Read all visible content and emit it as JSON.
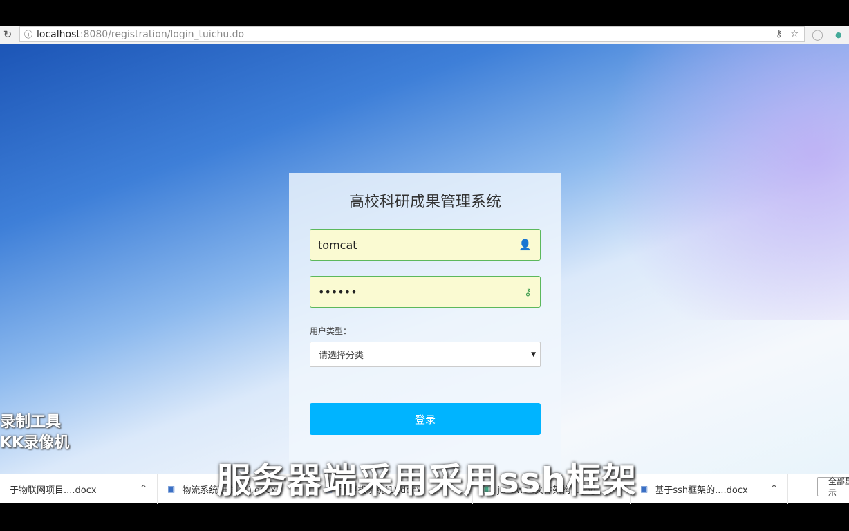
{
  "browser": {
    "url_host": "localhost",
    "url_path": ":8080/registration/login_tuichu.do"
  },
  "login": {
    "title": "高校科研成果管理系统",
    "username": "tomcat",
    "password": "••••••",
    "user_type_label": "用户类型：",
    "user_type_value": "请选择分类",
    "submit": "登录"
  },
  "watermark": {
    "line1": "录制工具",
    "line2": "KK录像机"
  },
  "subtitle": "服务器端采用采用ssh框架",
  "downloads": {
    "items": [
      "于物联网项目....docx",
      "物流系统研发 (1).docx",
      "计算机系统(1).docx",
      "javaweb文件架构....jpg",
      "基于ssh框架的....docx"
    ],
    "show_all": "全部显示"
  }
}
